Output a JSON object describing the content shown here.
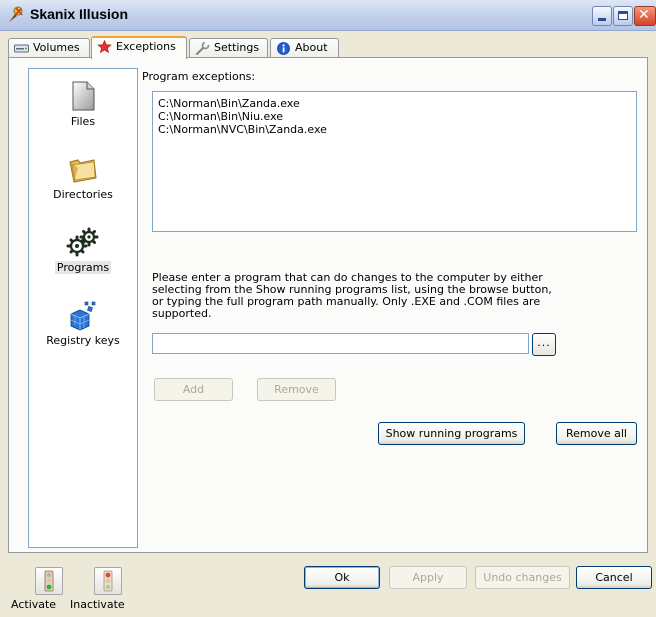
{
  "window": {
    "title": "Skanix Illusion"
  },
  "tabs": [
    {
      "label": "Volumes",
      "icon": "drive-icon"
    },
    {
      "label": "Exceptions",
      "icon": "star-icon",
      "active": true
    },
    {
      "label": "Settings",
      "icon": "wrench-icon"
    },
    {
      "label": "About",
      "icon": "info-icon"
    }
  ],
  "categories": [
    {
      "label": "Files",
      "icon": "file-icon"
    },
    {
      "label": "Directories",
      "icon": "folder-icon"
    },
    {
      "label": "Programs",
      "icon": "gears-icon",
      "selected": true
    },
    {
      "label": "Registry keys",
      "icon": "registry-cubes-icon"
    }
  ],
  "exceptions": {
    "label": "Program exceptions:",
    "items": [
      "C:\\Norman\\Bin\\Zanda.exe",
      "C:\\Norman\\Bin\\Niu.exe",
      "C:\\Norman\\NVC\\Bin\\Zanda.exe"
    ]
  },
  "help_text": "Please enter a program that can do changes to the computer by either selecting from the Show running programs list, using the browse button, or typing the full program path manually. Only .EXE and .COM files are supported.",
  "path_input": {
    "value": "",
    "placeholder": ""
  },
  "buttons": {
    "browse": "...",
    "add": "Add",
    "remove": "Remove",
    "show_running": "Show running programs",
    "remove_all": "Remove all",
    "ok": "Ok",
    "apply": "Apply",
    "undo": "Undo changes",
    "cancel": "Cancel"
  },
  "bottom": {
    "activate": "Activate",
    "inactivate": "Inactivate"
  },
  "colors": {
    "active_tab_accent": "#f0a43a",
    "list_border": "#7fa7c8",
    "button_border": "#003c74",
    "disabled_text": "#aca899"
  }
}
